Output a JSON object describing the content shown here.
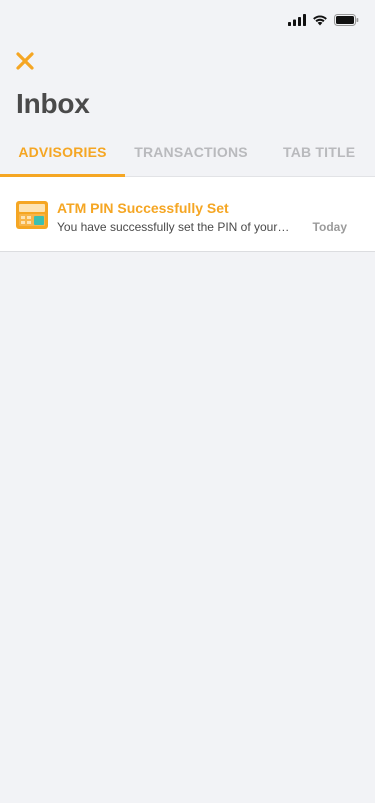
{
  "header": {
    "title": "Inbox"
  },
  "tabs": [
    {
      "label": "ADVISORIES",
      "active": true
    },
    {
      "label": "TRANSACTIONS",
      "active": false
    },
    {
      "label": "TAB TITLE",
      "active": false
    }
  ],
  "messages": [
    {
      "title": "ATM PIN Successfully Set",
      "preview": "You have successfully set the PIN of your…",
      "date": "Today",
      "icon": "atm-card-icon"
    }
  ],
  "colors": {
    "accent": "#f5a623",
    "title_text": "#4a4a4a",
    "inactive_tab": "#b9babd",
    "background": "#f2f3f6"
  }
}
